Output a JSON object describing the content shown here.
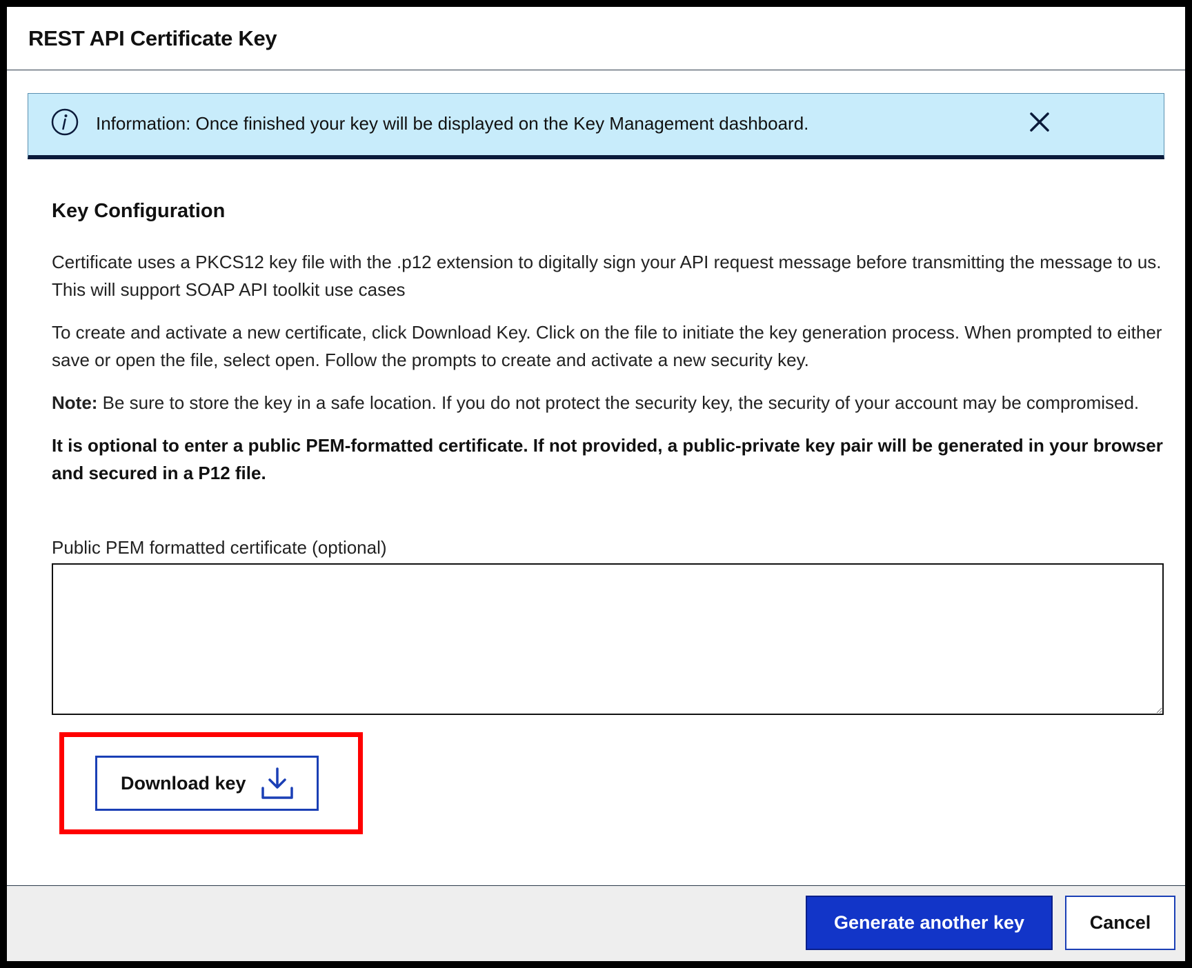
{
  "dialog": {
    "title": "REST API Certificate Key"
  },
  "banner": {
    "icon": "info-icon",
    "text": "Information: Once finished your key will be displayed on the Key Management dashboard.",
    "close_icon": "close-icon",
    "background_color": "#c8ecfb",
    "accent_color": "#0b1a3a"
  },
  "key_configuration": {
    "title": "Key Configuration",
    "para1": "Certificate uses a PKCS12 key file with the .p12 extension to digitally sign your API request message before transmitting the message to us. This will support SOAP API toolkit use cases",
    "para2": "To create and activate a new certificate, click Download Key. Click on the file to initiate the key generation process. When prompted to either save or open the file, select open. Follow the prompts to create and activate a new security key.",
    "note_label": "Note:",
    "note_text": " Be sure to store the key in a safe location. If you do not protect the security key, the security of your account may be compromised.",
    "optional_notice": "It is optional to enter a public PEM-formatted certificate. If not provided, a public-private key pair will be generated in your browser and secured in a P12 file."
  },
  "pem_field": {
    "label": "Public PEM formatted certificate (optional)",
    "value": ""
  },
  "download": {
    "label": "Download key",
    "icon": "download-icon",
    "highlight_color": "#ff0000"
  },
  "footer": {
    "generate_label": "Generate another key",
    "cancel_label": "Cancel",
    "primary_color": "#1235c8"
  }
}
